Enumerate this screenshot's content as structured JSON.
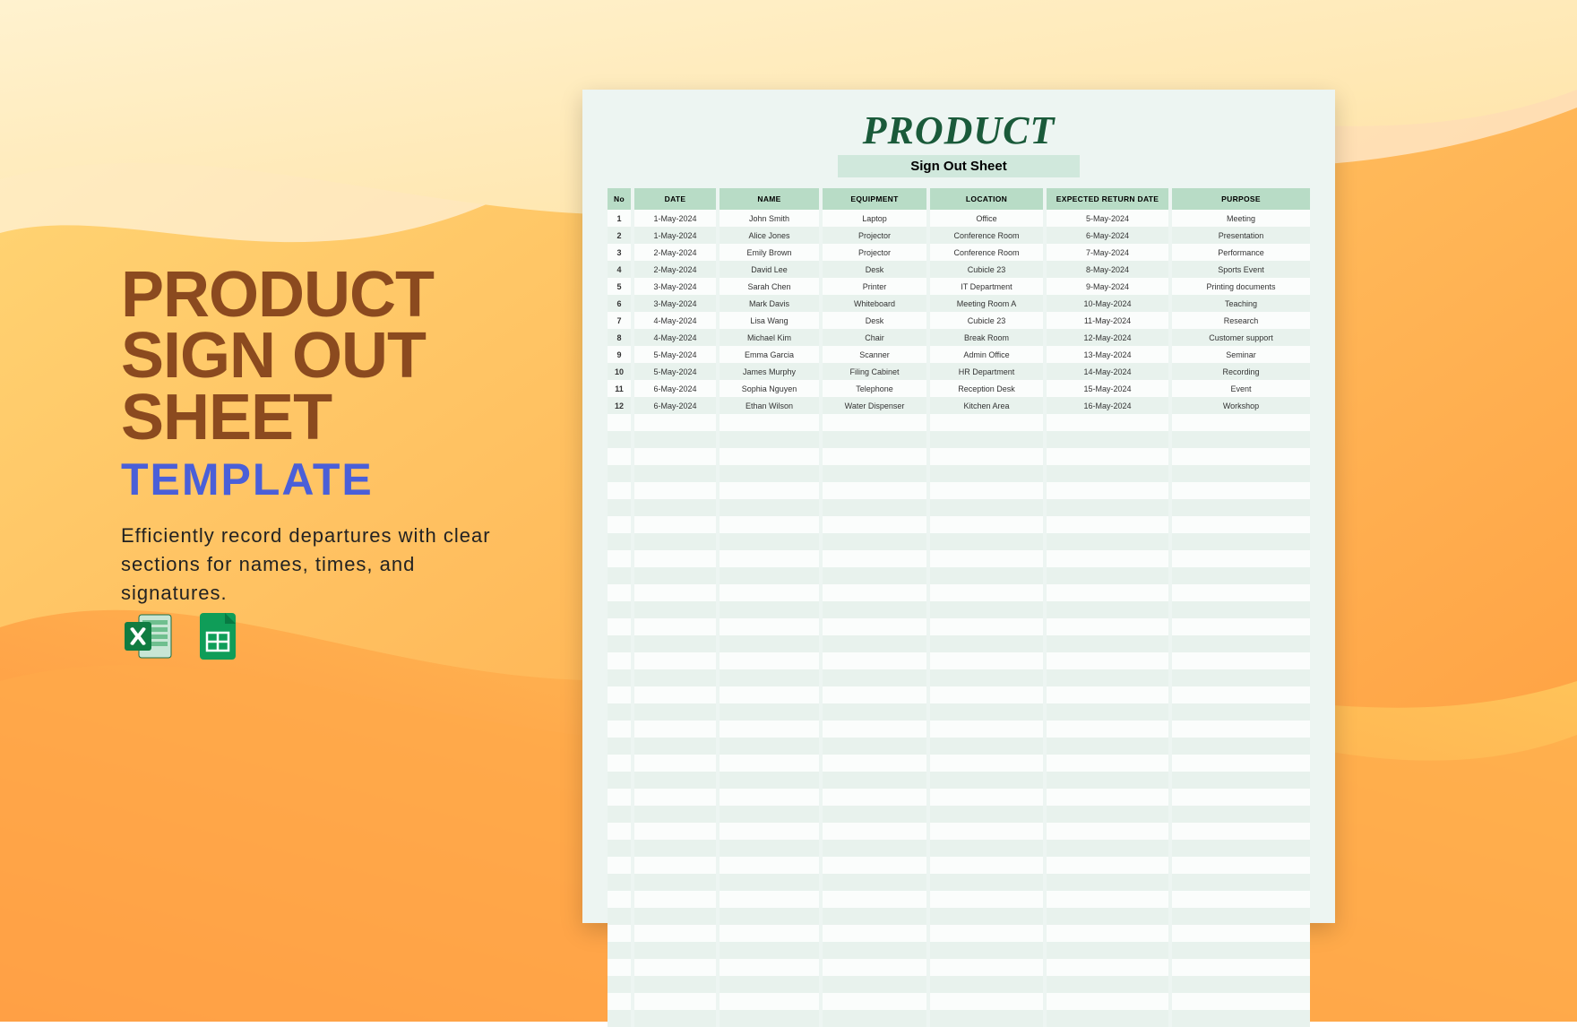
{
  "left": {
    "title_line1": "PRODUCT",
    "title_line2": "SIGN OUT",
    "title_line3": "SHEET",
    "subtitle": "TEMPLATE",
    "description": "Efficiently record departures with clear sections for names, times, and signatures."
  },
  "sheet": {
    "heading": "PRODUCT",
    "subheading": "Sign Out Sheet",
    "columns": [
      "No",
      "DATE",
      "NAME",
      "EQUIPMENT",
      "LOCATION",
      "EXPECTED RETURN DATE",
      "PURPOSE"
    ],
    "rows": [
      {
        "no": "1",
        "date": "1-May-2024",
        "name": "John Smith",
        "equipment": "Laptop",
        "location": "Office",
        "return": "5-May-2024",
        "purpose": "Meeting"
      },
      {
        "no": "2",
        "date": "1-May-2024",
        "name": "Alice Jones",
        "equipment": "Projector",
        "location": "Conference Room",
        "return": "6-May-2024",
        "purpose": "Presentation"
      },
      {
        "no": "3",
        "date": "2-May-2024",
        "name": "Emily Brown",
        "equipment": "Projector",
        "location": "Conference Room",
        "return": "7-May-2024",
        "purpose": "Performance"
      },
      {
        "no": "4",
        "date": "2-May-2024",
        "name": "David Lee",
        "equipment": "Desk",
        "location": "Cubicle 23",
        "return": "8-May-2024",
        "purpose": "Sports Event"
      },
      {
        "no": "5",
        "date": "3-May-2024",
        "name": "Sarah Chen",
        "equipment": "Printer",
        "location": "IT Department",
        "return": "9-May-2024",
        "purpose": "Printing documents"
      },
      {
        "no": "6",
        "date": "3-May-2024",
        "name": "Mark Davis",
        "equipment": "Whiteboard",
        "location": "Meeting Room A",
        "return": "10-May-2024",
        "purpose": "Teaching"
      },
      {
        "no": "7",
        "date": "4-May-2024",
        "name": "Lisa Wang",
        "equipment": "Desk",
        "location": "Cubicle 23",
        "return": "11-May-2024",
        "purpose": "Research"
      },
      {
        "no": "8",
        "date": "4-May-2024",
        "name": "Michael Kim",
        "equipment": "Chair",
        "location": "Break Room",
        "return": "12-May-2024",
        "purpose": "Customer support"
      },
      {
        "no": "9",
        "date": "5-May-2024",
        "name": "Emma Garcia",
        "equipment": "Scanner",
        "location": "Admin Office",
        "return": "13-May-2024",
        "purpose": "Seminar"
      },
      {
        "no": "10",
        "date": "5-May-2024",
        "name": "James Murphy",
        "equipment": "Filing Cabinet",
        "location": "HR Department",
        "return": "14-May-2024",
        "purpose": "Recording"
      },
      {
        "no": "11",
        "date": "6-May-2024",
        "name": "Sophia Nguyen",
        "equipment": "Telephone",
        "location": "Reception Desk",
        "return": "15-May-2024",
        "purpose": "Event"
      },
      {
        "no": "12",
        "date": "6-May-2024",
        "name": "Ethan Wilson",
        "equipment": "Water Dispenser",
        "location": "Kitchen Area",
        "return": "16-May-2024",
        "purpose": "Workshop"
      }
    ],
    "empty_rows": 36
  }
}
